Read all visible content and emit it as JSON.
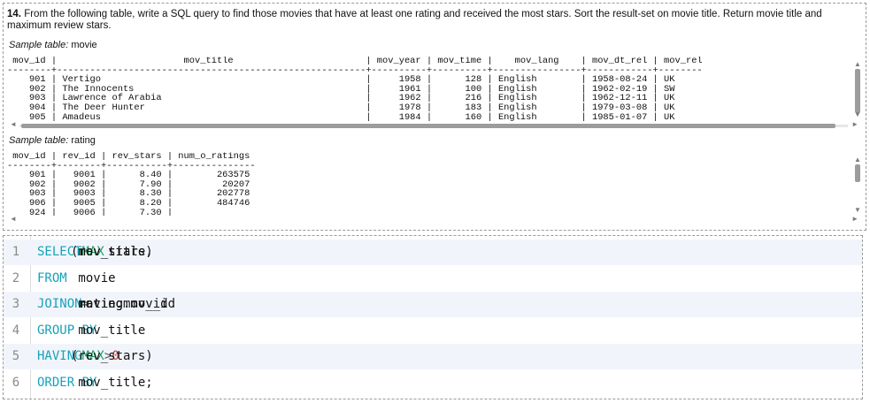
{
  "question": {
    "number": "14.",
    "text": "From the following table, write a SQL query to find those movies that have at least one rating and received the most stars. Sort the result-set on movie title. Return movie title and maximum review stars."
  },
  "movie_table": {
    "label_italic": "Sample table:",
    "label_name": "movie",
    "text": " mov_id |                       mov_title                        | mov_year | mov_time |    mov_lang    | mov_dt_rel | mov_rel\n--------+--------------------------------------------------------+----------+----------+----------------+------------+--------\n    901 | Vertigo                                                |     1958 |      128 | English        | 1958-08-24 | UK\n    902 | The Innocents                                          |     1961 |      100 | English        | 1962-02-19 | SW\n    903 | Lawrence of Arabia                                     |     1962 |      216 | English        | 1962-12-11 | UK\n    904 | The Deer Hunter                                        |     1978 |      183 | English        | 1979-03-08 | UK\n    905 | Amadeus                                                |     1984 |      160 | English        | 1985-01-07 | UK"
  },
  "rating_table": {
    "label_italic": "Sample table:",
    "label_name": "rating",
    "text": " mov_id | rev_id | rev_stars | num_o_ratings\n--------+--------+-----------+---------------\n    901 |   9001 |      8.40 |        263575\n    902 |   9002 |      7.90 |         20207\n    903 |   9003 |      8.30 |        202778\n    906 |   9005 |      8.20 |        484746\n    924 |   9006 |      7.30 |"
  },
  "scroll_icons": {
    "left": "◄",
    "right": "►",
    "up": "▲",
    "down": "▼"
  },
  "code": {
    "lines": [
      {
        "n": "1",
        "parts": [
          [
            "kw",
            "SELECT"
          ],
          [
            "tx",
            " mov_title, "
          ],
          [
            "fn",
            "MAX"
          ],
          [
            "tx",
            "(rev_stars)"
          ]
        ]
      },
      {
        "n": "2",
        "parts": [
          [
            "kw",
            "FROM"
          ],
          [
            "tx",
            " movie"
          ]
        ]
      },
      {
        "n": "3",
        "parts": [
          [
            "kw",
            "JOIN"
          ],
          [
            "tx",
            " rating "
          ],
          [
            "kw",
            "ON"
          ],
          [
            "tx",
            " movie.mov_id "
          ],
          [
            "op",
            "="
          ],
          [
            "tx",
            " rating.mov_id"
          ]
        ]
      },
      {
        "n": "4",
        "parts": [
          [
            "kw",
            "GROUP BY"
          ],
          [
            "tx",
            " mov_title"
          ]
        ]
      },
      {
        "n": "5",
        "parts": [
          [
            "kw",
            "HAVING"
          ],
          [
            "tx",
            " "
          ],
          [
            "fn",
            "MAX"
          ],
          [
            "tx",
            "(rev_stars) "
          ],
          [
            "op",
            ">"
          ],
          [
            "tx",
            " "
          ],
          [
            "num",
            "0"
          ]
        ]
      },
      {
        "n": "6",
        "parts": [
          [
            "kw",
            "ORDER BY"
          ],
          [
            "tx",
            " mov_title;"
          ]
        ]
      }
    ]
  },
  "colors": {
    "keyword": "#17a2b8",
    "function": "#1e9c60",
    "number": "#c0392b",
    "line_highlight": "#f1f5fb"
  }
}
